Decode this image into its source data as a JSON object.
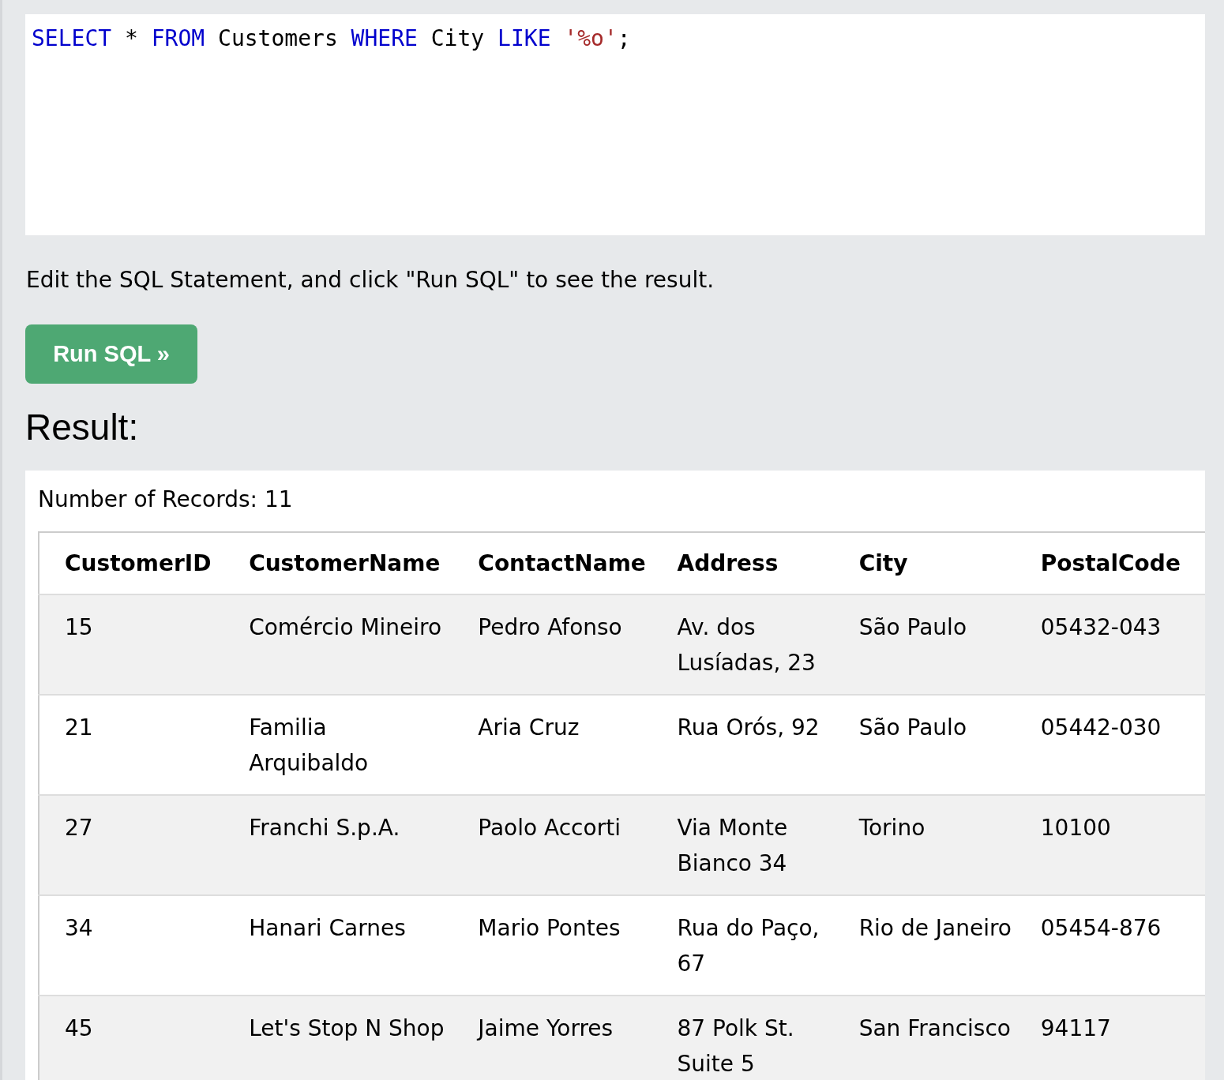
{
  "editor": {
    "tokens": [
      {
        "kind": "keyword",
        "text": "SELECT"
      },
      {
        "kind": "plain",
        "text": " * "
      },
      {
        "kind": "keyword",
        "text": "FROM"
      },
      {
        "kind": "plain",
        "text": " Customers "
      },
      {
        "kind": "keyword",
        "text": "WHERE"
      },
      {
        "kind": "plain",
        "text": " City "
      },
      {
        "kind": "keyword",
        "text": "LIKE"
      },
      {
        "kind": "string",
        "text": " '%o'"
      },
      {
        "kind": "plain",
        "text": ";"
      }
    ]
  },
  "instruction": "Edit the SQL Statement, and click \"Run SQL\" to see the result.",
  "run_button": "Run SQL »",
  "result_heading": "Result:",
  "record_count": "Number of Records: 11",
  "table": {
    "columns": [
      "CustomerID",
      "CustomerName",
      "ContactName",
      "Address",
      "City",
      "PostalCode"
    ],
    "rows": [
      [
        "15",
        "Comércio Mineiro",
        "Pedro Afonso",
        "Av. dos Lusíadas, 23",
        "São Paulo",
        "05432-043"
      ],
      [
        "21",
        "Familia Arquibaldo",
        "Aria Cruz",
        "Rua Orós, 92",
        "São Paulo",
        "05442-030"
      ],
      [
        "27",
        "Franchi S.p.A.",
        "Paolo Accorti",
        "Via Monte Bianco 34",
        "Torino",
        "10100"
      ],
      [
        "34",
        "Hanari Carnes",
        "Mario Pontes",
        "Rua do Paço, 67",
        "Rio de Janeiro",
        "05454-876"
      ],
      [
        "45",
        "Let's Stop N Shop",
        "Jaime Yorres",
        "87 Polk St. Suite 5",
        "San Francisco",
        "94117"
      ]
    ]
  }
}
